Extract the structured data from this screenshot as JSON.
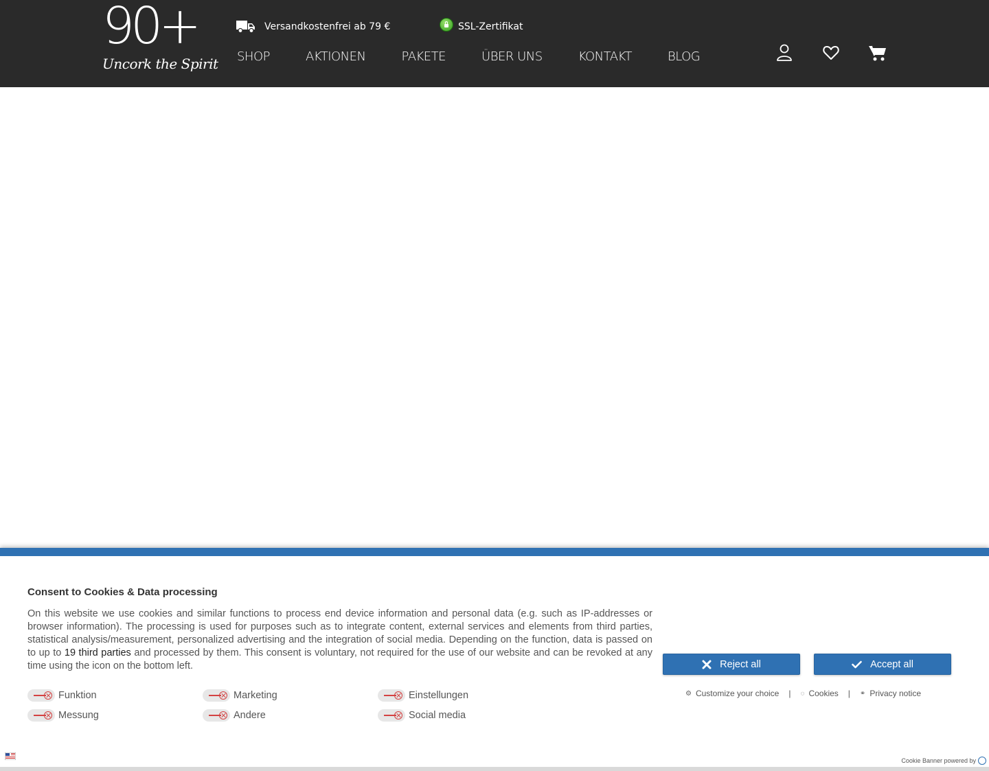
{
  "header": {
    "logo_number": "90+",
    "logo_tagline": "Uncork the Spirit",
    "shipping_text": "Versandkostenfrei ab 79 €",
    "ssl_text": "SSL-Zertifikat",
    "nav": [
      "SHOP",
      "AKTIONEN",
      "PAKETE",
      "ÜBER UNS",
      "KONTAKT",
      "BLOG"
    ],
    "icons": [
      "user-icon",
      "heart-icon",
      "cart-icon"
    ]
  },
  "cookie_banner": {
    "title": "Consent to Cookies & Data processing",
    "text_before_link": "On this website we use cookies and similar functions to process end device information and personal data (e.g. such as IP-addresses or browser information). The processing is used for purposes such as to integrate content, external services and elements from third parties, statistical analysis/measurement, personalized advertising and the integration of social media. Depending on the function, data is passed on to up to ",
    "third_parties_link": "19 third parties",
    "text_after_link": " and processed by them. This consent is voluntary, not required for the use of our website and can be revoked at any time using the icon on the bottom left.",
    "categories": [
      {
        "label": "Funktion",
        "enabled": false
      },
      {
        "label": "Marketing",
        "enabled": false
      },
      {
        "label": "Einstellungen",
        "enabled": false
      },
      {
        "label": "Messung",
        "enabled": false
      },
      {
        "label": "Andere",
        "enabled": false
      },
      {
        "label": "Social media",
        "enabled": false
      }
    ],
    "reject_label": "Reject all",
    "accept_label": "Accept all",
    "customize_label": "Customize your choice",
    "cookies_label": "Cookies",
    "privacy_label": "Privacy notice",
    "separator": "|",
    "powered_by": "Cookie Banner powered by"
  },
  "colors": {
    "header_bg": "#2a2a2a",
    "accent_blue": "#2f71b3",
    "toggle_off_red": "#d34242"
  }
}
